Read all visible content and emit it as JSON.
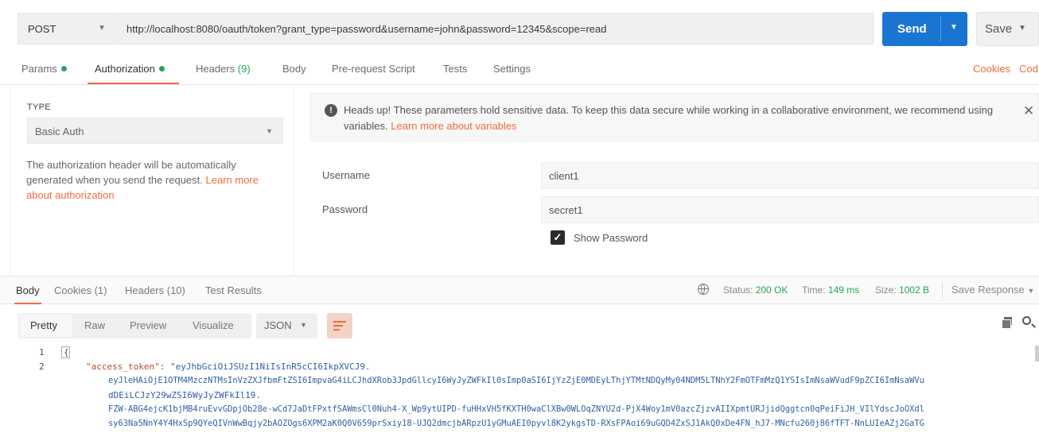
{
  "request": {
    "method": "POST",
    "url": "http://localhost:8080/oauth/token?grant_type=password&username=john&password=12345&scope=read",
    "send_label": "Send",
    "save_label": "Save"
  },
  "tabs": {
    "params": "Params",
    "authorization": "Authorization",
    "headers": "Headers",
    "headers_count": "(9)",
    "body": "Body",
    "prerequest": "Pre-request Script",
    "tests": "Tests",
    "settings": "Settings",
    "cookies": "Cookies",
    "code": "Cod"
  },
  "auth": {
    "type_label": "TYPE",
    "type_value": "Basic Auth",
    "desc": "The authorization header will be automatically generated when you send the request.",
    "learn_more": "Learn more about authorization",
    "warning": "Heads up! These parameters hold sensitive data. To keep this data secure while working in a collaborative environment, we recommend using variables.",
    "warning_link": "Learn more about variables",
    "username_label": "Username",
    "username_value": "client1",
    "password_label": "Password",
    "password_value": "secret1",
    "show_password_label": "Show Password",
    "show_password_checked": true
  },
  "response": {
    "tabs": {
      "body": "Body",
      "cookies": "Cookies (1)",
      "headers": "Headers (10)",
      "test_results": "Test Results"
    },
    "status_label": "Status:",
    "status_value": "200 OK",
    "time_label": "Time:",
    "time_value": "149 ms",
    "size_label": "Size:",
    "size_value": "1002 B",
    "save_response": "Save Response",
    "views": {
      "pretty": "Pretty",
      "raw": "Raw",
      "preview": "Preview",
      "visualize": "Visualize"
    },
    "format": "JSON"
  },
  "code": {
    "line1_no": "1",
    "line2_no": "2",
    "line1": "{",
    "key": "\"access_token\"",
    "colon": ": ",
    "val1": "\"eyJhbGciOiJSUzI1NiIsInR5cCI6IkpXVCJ9.",
    "val2": "eyJleHAiOjE1OTM4MzczNTMsInVzZXJfbmFtZSI6ImpvaG4iLCJhdXRob3JpdGllcyI6WyJyZWFkIl0sImp0aSI6IjYzZjE0MDEyLThjYTMtNDQyMy04NDM5LTNhY2FmOTFmMzQ1YSIsImNsaWVudF9pZCI6ImNsaWVu",
    "val3": "dDEiLCJzY29wZSI6WyJyZWFkIl19.",
    "val4": "FZW-ABG4ejcK1bjMB4ruEvvGDpjOb28e-wCd7JaDtFPxtfSAWmsCl0Nuh4-X_Wp9ytUIPD-fuHHxVH5fKXTH0waClXBw0WLOqZNYU2d-PjX4Woy1mV0azcZjzvAIIXpmtURJjidQggtcn0qPeiFiJH_VIlYdscJoOXdl",
    "val5": "sy63Na5NnY4Y4HxSp9QYeQIVnWwBqjy2bAOZOgs6XPM2aK0Q0V659prSxiy18-UJQ2dmcjbARpzU1yGMuAEI0pyvl8K2ykgsTD-RXsFPAoi69uGQD4ZxSJ1AkQ0xDe4FN_hJ7-MNcfu260j86fTFT-NnLUIeAZj2GaTG"
  }
}
